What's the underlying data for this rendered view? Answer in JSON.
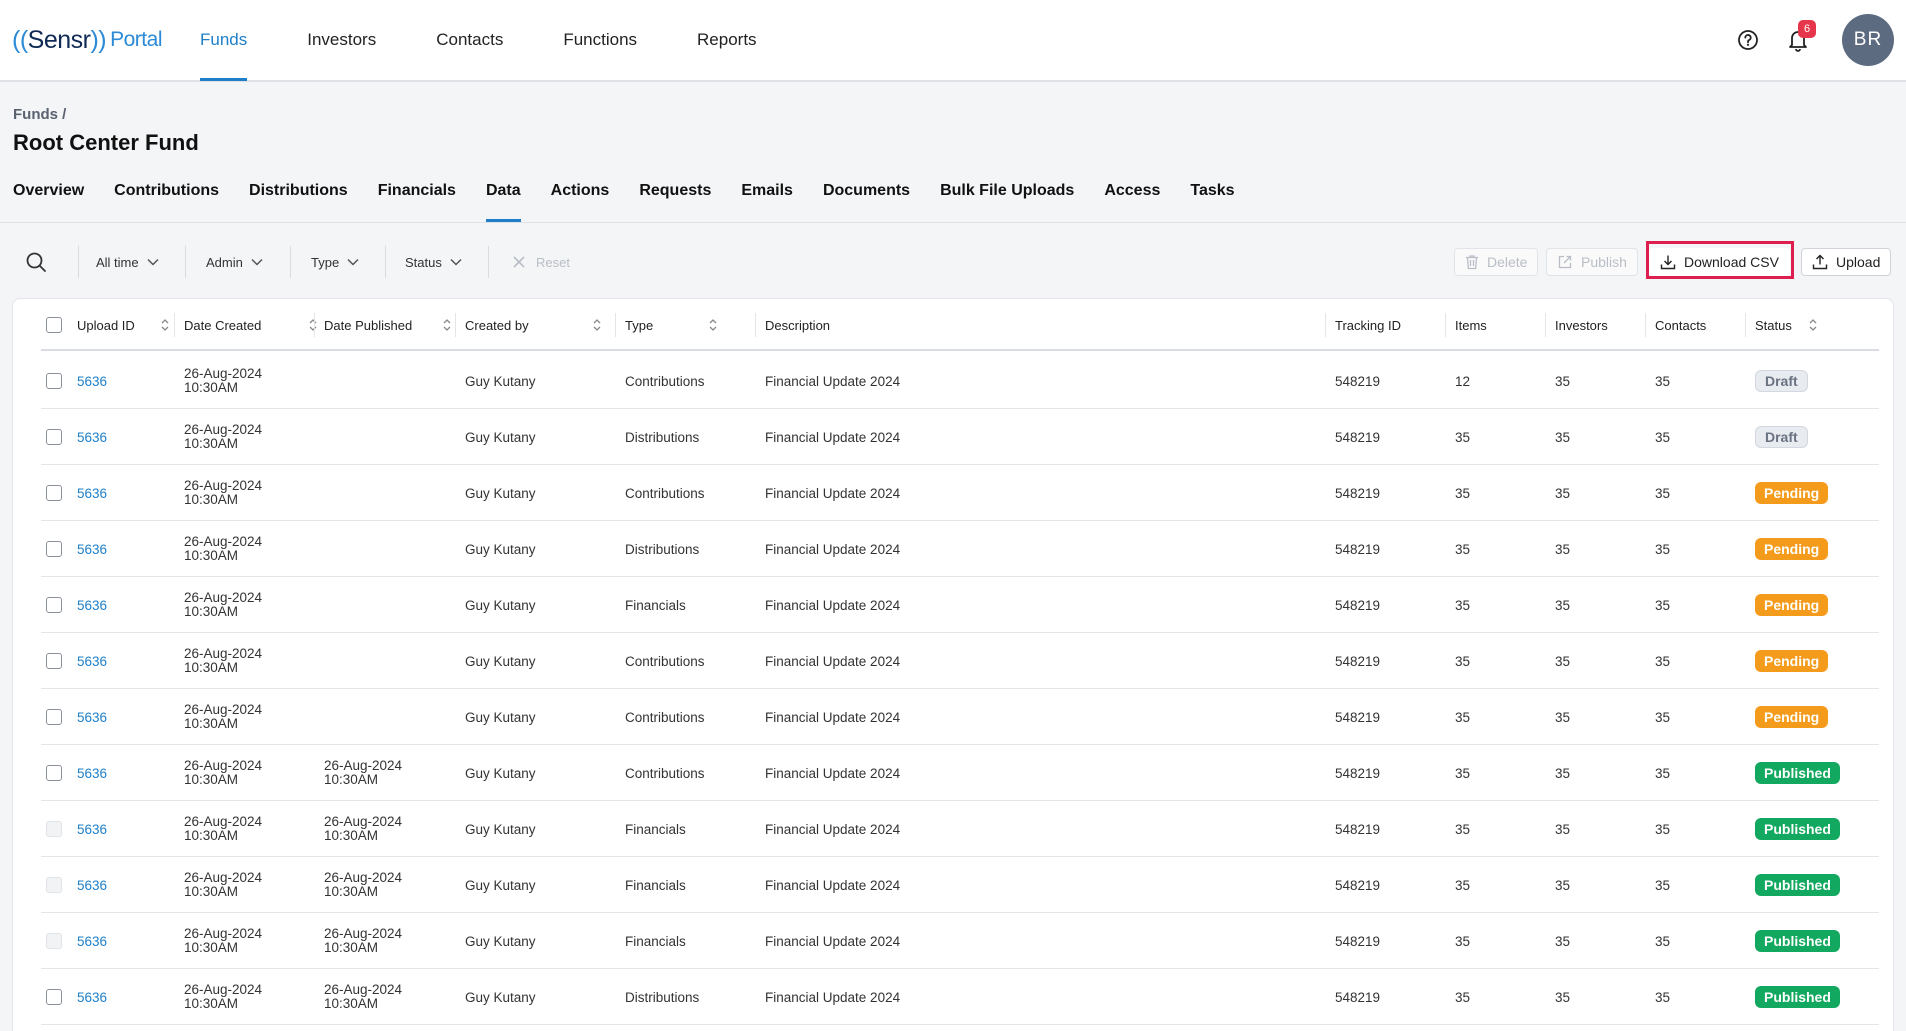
{
  "logo": {
    "open": "((",
    "brand": "Sensr",
    "close": "))",
    "portal": "Portal"
  },
  "nav": {
    "items": [
      "Funds",
      "Investors",
      "Contacts",
      "Functions",
      "Reports"
    ],
    "active": 0
  },
  "notifications": {
    "count": "6"
  },
  "user": {
    "initials": "BR"
  },
  "breadcrumb": "Funds /",
  "page_title": "Root Center Fund",
  "subtabs": {
    "items": [
      "Overview",
      "Contributions",
      "Distributions",
      "Financials",
      "Data",
      "Actions",
      "Requests",
      "Emails",
      "Documents",
      "Bulk File Uploads",
      "Access",
      "Tasks"
    ],
    "active": 4
  },
  "filters": {
    "time": "All time",
    "admin": "Admin",
    "type": "Type",
    "status": "Status",
    "reset": "Reset"
  },
  "actions": {
    "delete": "Delete",
    "publish": "Publish",
    "download_csv": "Download CSV",
    "upload": "Upload"
  },
  "table": {
    "columns": {
      "upload_id": "Upload ID",
      "date_created": "Date Created",
      "date_published": "Date Published",
      "created_by": "Created by",
      "type": "Type",
      "description": "Description",
      "tracking_id": "Tracking ID",
      "items": "Items",
      "investors": "Investors",
      "contacts": "Contacts",
      "status": "Status"
    },
    "rows": [
      {
        "id": "5636",
        "created_date": "26-Aug-2024",
        "created_time": "10:30AM",
        "pub_date": "",
        "pub_time": "",
        "by": "Guy Kutany",
        "type": "Contributions",
        "desc": "Financial Update 2024",
        "tracking": "548219",
        "items": "12",
        "investors": "35",
        "contacts": "35",
        "status": "Draft",
        "status_kind": "draft",
        "cb_dim": false
      },
      {
        "id": "5636",
        "created_date": "26-Aug-2024",
        "created_time": "10:30AM",
        "pub_date": "",
        "pub_time": "",
        "by": "Guy Kutany",
        "type": "Distributions",
        "desc": "Financial Update 2024",
        "tracking": "548219",
        "items": "35",
        "investors": "35",
        "contacts": "35",
        "status": "Draft",
        "status_kind": "draft",
        "cb_dim": false
      },
      {
        "id": "5636",
        "created_date": "26-Aug-2024",
        "created_time": "10:30AM",
        "pub_date": "",
        "pub_time": "",
        "by": "Guy Kutany",
        "type": "Contributions",
        "desc": "Financial Update 2024",
        "tracking": "548219",
        "items": "35",
        "investors": "35",
        "contacts": "35",
        "status": "Pending",
        "status_kind": "pending",
        "cb_dim": false
      },
      {
        "id": "5636",
        "created_date": "26-Aug-2024",
        "created_time": "10:30AM",
        "pub_date": "",
        "pub_time": "",
        "by": "Guy Kutany",
        "type": "Distributions",
        "desc": "Financial Update 2024",
        "tracking": "548219",
        "items": "35",
        "investors": "35",
        "contacts": "35",
        "status": "Pending",
        "status_kind": "pending",
        "cb_dim": false
      },
      {
        "id": "5636",
        "created_date": "26-Aug-2024",
        "created_time": "10:30AM",
        "pub_date": "",
        "pub_time": "",
        "by": "Guy Kutany",
        "type": "Financials",
        "desc": "Financial Update 2024",
        "tracking": "548219",
        "items": "35",
        "investors": "35",
        "contacts": "35",
        "status": "Pending",
        "status_kind": "pending",
        "cb_dim": false
      },
      {
        "id": "5636",
        "created_date": "26-Aug-2024",
        "created_time": "10:30AM",
        "pub_date": "",
        "pub_time": "",
        "by": "Guy Kutany",
        "type": "Contributions",
        "desc": "Financial Update 2024",
        "tracking": "548219",
        "items": "35",
        "investors": "35",
        "contacts": "35",
        "status": "Pending",
        "status_kind": "pending",
        "cb_dim": false
      },
      {
        "id": "5636",
        "created_date": "26-Aug-2024",
        "created_time": "10:30AM",
        "pub_date": "",
        "pub_time": "",
        "by": "Guy Kutany",
        "type": "Contributions",
        "desc": "Financial Update 2024",
        "tracking": "548219",
        "items": "35",
        "investors": "35",
        "contacts": "35",
        "status": "Pending",
        "status_kind": "pending",
        "cb_dim": false
      },
      {
        "id": "5636",
        "created_date": "26-Aug-2024",
        "created_time": "10:30AM",
        "pub_date": "26-Aug-2024",
        "pub_time": "10:30AM",
        "by": "Guy Kutany",
        "type": "Contributions",
        "desc": "Financial Update 2024",
        "tracking": "548219",
        "items": "35",
        "investors": "35",
        "contacts": "35",
        "status": "Published",
        "status_kind": "published",
        "cb_dim": false
      },
      {
        "id": "5636",
        "created_date": "26-Aug-2024",
        "created_time": "10:30AM",
        "pub_date": "26-Aug-2024",
        "pub_time": "10:30AM",
        "by": "Guy Kutany",
        "type": "Financials",
        "desc": "Financial Update 2024",
        "tracking": "548219",
        "items": "35",
        "investors": "35",
        "contacts": "35",
        "status": "Published",
        "status_kind": "published",
        "cb_dim": true
      },
      {
        "id": "5636",
        "created_date": "26-Aug-2024",
        "created_time": "10:30AM",
        "pub_date": "26-Aug-2024",
        "pub_time": "10:30AM",
        "by": "Guy Kutany",
        "type": "Financials",
        "desc": "Financial Update 2024",
        "tracking": "548219",
        "items": "35",
        "investors": "35",
        "contacts": "35",
        "status": "Published",
        "status_kind": "published",
        "cb_dim": true
      },
      {
        "id": "5636",
        "created_date": "26-Aug-2024",
        "created_time": "10:30AM",
        "pub_date": "26-Aug-2024",
        "pub_time": "10:30AM",
        "by": "Guy Kutany",
        "type": "Financials",
        "desc": "Financial Update 2024",
        "tracking": "548219",
        "items": "35",
        "investors": "35",
        "contacts": "35",
        "status": "Published",
        "status_kind": "published",
        "cb_dim": true
      },
      {
        "id": "5636",
        "created_date": "26-Aug-2024",
        "created_time": "10:30AM",
        "pub_date": "26-Aug-2024",
        "pub_time": "10:30AM",
        "by": "Guy Kutany",
        "type": "Distributions",
        "desc": "Financial Update 2024",
        "tracking": "548219",
        "items": "35",
        "investors": "35",
        "contacts": "35",
        "status": "Published",
        "status_kind": "published",
        "cb_dim": false
      }
    ]
  }
}
